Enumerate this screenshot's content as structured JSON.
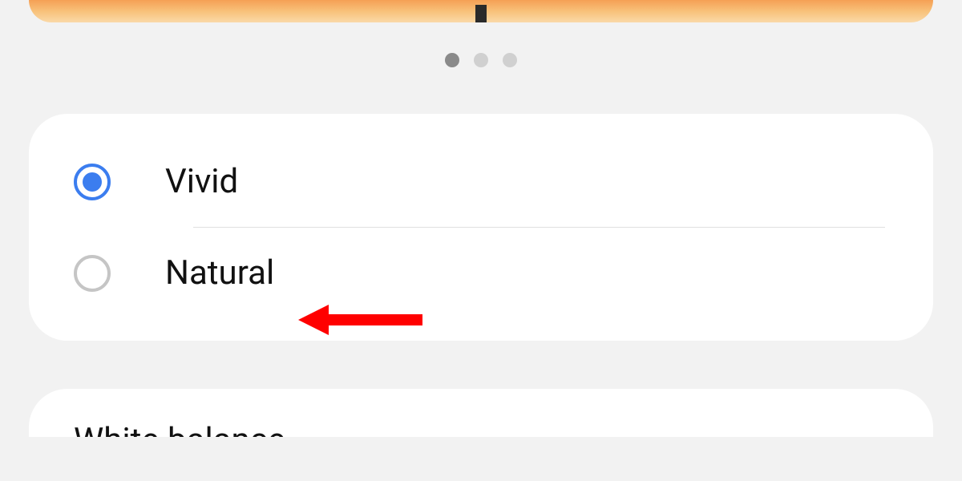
{
  "pager": {
    "total": 3,
    "active_index": 0
  },
  "screen_mode_card": {
    "options": [
      {
        "label": "Vivid",
        "selected": true
      },
      {
        "label": "Natural",
        "selected": false
      }
    ]
  },
  "next_card": {
    "partial_heading": "White balance"
  },
  "colors": {
    "accent": "#3b7def",
    "annotation": "#ff0000"
  }
}
